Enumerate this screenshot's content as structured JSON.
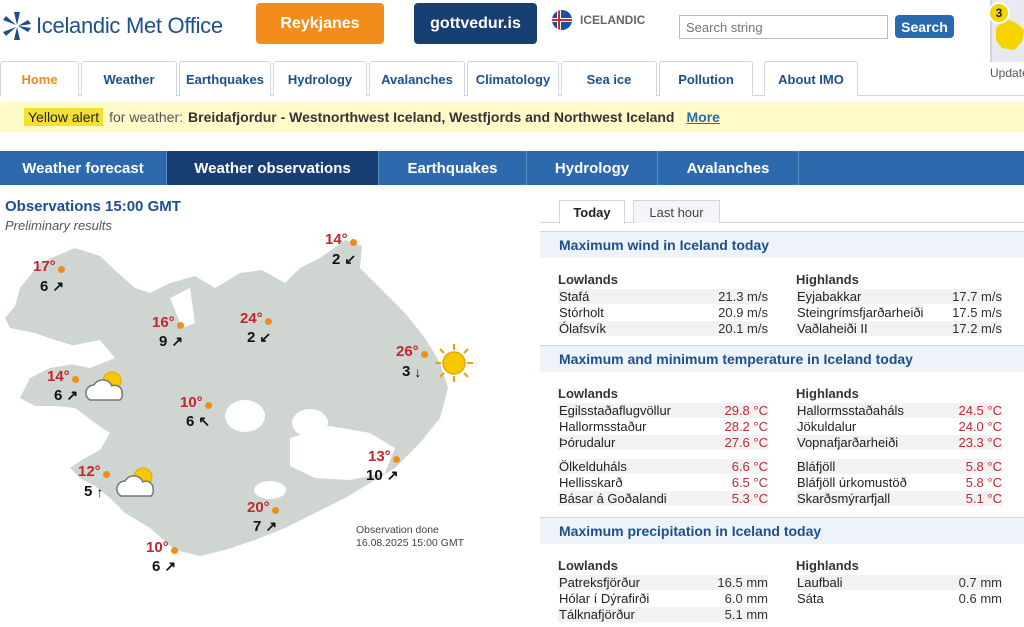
{
  "header": {
    "logo_text": "Icelandic Met Office",
    "btn_reykjanes": "Reykjanes",
    "btn_gottvedur": "gottvedur.is",
    "language": "ICELANDIC",
    "search_placeholder": "Search string",
    "search_button": "Search",
    "update_count": "3",
    "update_label": "Update"
  },
  "tabs": [
    "Home",
    "Weather",
    "Earthquakes",
    "Hydrology",
    "Avalanches",
    "Climatology",
    "Sea ice",
    "Pollution",
    "About IMO"
  ],
  "alert": {
    "tag": "Yellow alert",
    "label": "for weather:",
    "area": "Breidafjordur - Westnorthwest Iceland, Westfjords and Northwest Iceland",
    "more": "More"
  },
  "subnav": [
    "Weather forecast",
    "Weather observations",
    "Earthquakes",
    "Hydrology",
    "Avalanches"
  ],
  "observations": {
    "title": "Observations 15:00 GMT",
    "subtitle": "Preliminary results",
    "done_line1": "Observation done",
    "done_line2": "16.08.2025 15:00 GMT",
    "stations": [
      {
        "temp": "17°",
        "wind": "6",
        "dir": "↗"
      },
      {
        "temp": "14°",
        "wind": "2",
        "dir": "↙"
      },
      {
        "temp": "16°",
        "wind": "9",
        "dir": "↗"
      },
      {
        "temp": "24°",
        "wind": "2",
        "dir": "↙"
      },
      {
        "temp": "26°",
        "wind": "3",
        "dir": "↓"
      },
      {
        "temp": "14°",
        "wind": "6",
        "dir": "↗"
      },
      {
        "temp": "10°",
        "wind": "6",
        "dir": "↖"
      },
      {
        "temp": "13°",
        "wind": "10",
        "dir": "↗"
      },
      {
        "temp": "12°",
        "wind": "5",
        "dir": "↑"
      },
      {
        "temp": "20°",
        "wind": "7",
        "dir": "↗"
      },
      {
        "temp": "10°",
        "wind": "6",
        "dir": "↗"
      }
    ]
  },
  "right_tabs": [
    "Today",
    "Last hour"
  ],
  "sections": {
    "wind": {
      "title": "Maximum wind in Iceland today",
      "lowlands_label": "Lowlands",
      "highlands_label": "Highlands",
      "lowlands": [
        [
          "Stafá",
          "21.3 m/s"
        ],
        [
          "Stórholt",
          "20.9 m/s"
        ],
        [
          "Ólafsvík",
          "20.1 m/s"
        ]
      ],
      "highlands": [
        [
          "Eyjabakkar",
          "17.7 m/s"
        ],
        [
          "Steingrímsfjarðarheiði",
          "17.5 m/s"
        ],
        [
          "Vaðlaheiði II",
          "17.2 m/s"
        ]
      ]
    },
    "temp": {
      "title": "Maximum and minimum temperature in Iceland today",
      "lowlands_label": "Lowlands",
      "highlands_label": "Highlands",
      "lowlands_max": [
        [
          "Egilsstaðaflugvöllur",
          "29.8 °C"
        ],
        [
          "Hallormsstaður",
          "28.2 °C"
        ],
        [
          "Þórudalur",
          "27.6 °C"
        ]
      ],
      "lowlands_min": [
        [
          "Ölkelduháls",
          "6.6 °C"
        ],
        [
          "Hellisskarð",
          "6.5 °C"
        ],
        [
          "Básar á Goðalandi",
          "5.3 °C"
        ]
      ],
      "highlands_max": [
        [
          "Hallormsstaðaháls",
          "24.5 °C"
        ],
        [
          "Jökuldalur",
          "24.0 °C"
        ],
        [
          "Vopnafjarðarheiði",
          "23.3 °C"
        ]
      ],
      "highlands_min": [
        [
          "Bláfjöll",
          "5.8 °C"
        ],
        [
          "Bláfjöll úrkomustöð",
          "5.8 °C"
        ],
        [
          "Skarðsmýrarfjall",
          "5.1 °C"
        ]
      ]
    },
    "precip": {
      "title": "Maximum precipitation in Iceland today",
      "lowlands_label": "Lowlands",
      "highlands_label": "Highlands",
      "lowlands": [
        [
          "Patreksfjörður",
          "16.5 mm"
        ],
        [
          "Hólar í Dýrafirði",
          "6.0 mm"
        ],
        [
          "Tálknafjörður",
          "5.1 mm"
        ]
      ],
      "highlands": [
        [
          "Laufbali",
          "0.7 mm"
        ],
        [
          "Sáta",
          "0.6 mm"
        ]
      ]
    }
  },
  "colors": {
    "brand_blue": "#1d4f8c",
    "nav_blue": "#2d6aad",
    "dark_blue": "#173f73",
    "orange": "#f28c1a",
    "alert_yellow": "#fffbc9",
    "temp_red": "#c0282d"
  }
}
